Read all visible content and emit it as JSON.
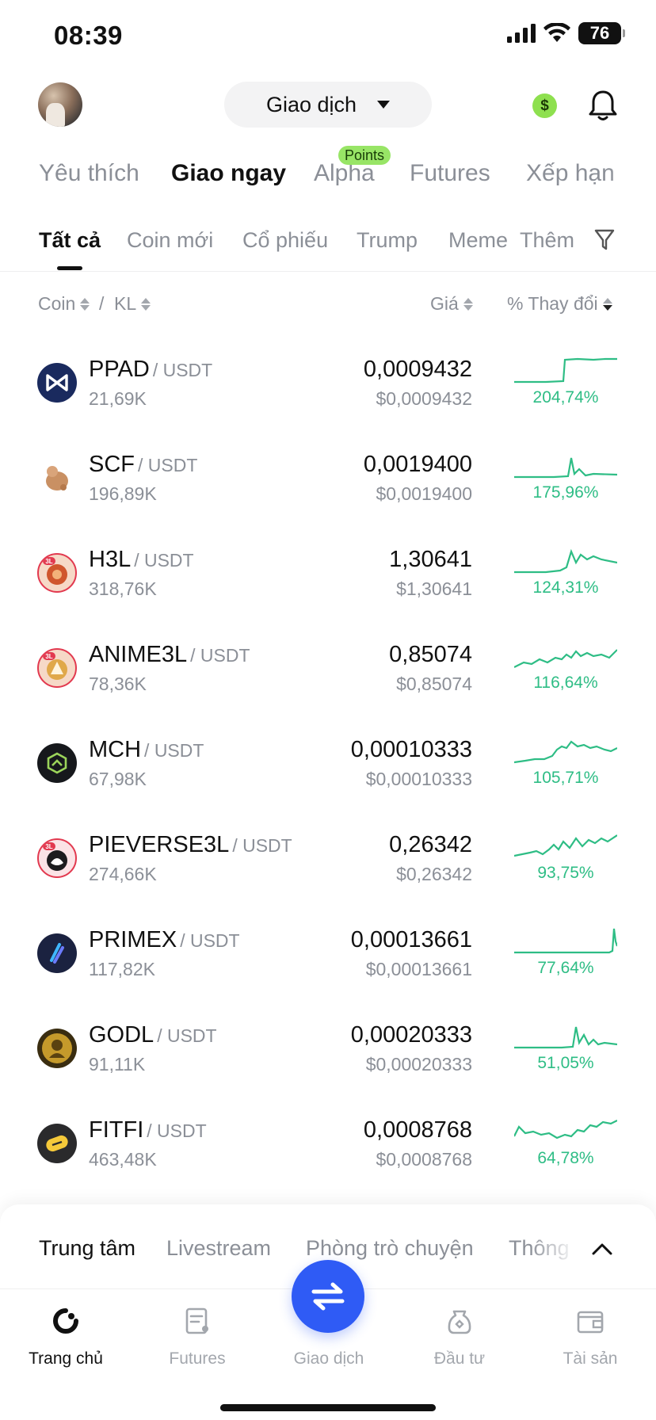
{
  "status_bar": {
    "time": "08:39",
    "battery": "76"
  },
  "header": {
    "title": "Giao dịch",
    "points_badge": "Points"
  },
  "main_tabs": [
    "Yêu thích",
    "Giao ngay",
    "Alpha",
    "Futures",
    "Xếp hạn"
  ],
  "sub_tabs": [
    "Tất cả",
    "Coin mới",
    "Cổ phiếu",
    "Trump",
    "Meme",
    "Thêm"
  ],
  "columns": {
    "coin": "Coin",
    "separator": "/",
    "volume": "KL",
    "price": "Giá",
    "change": "% Thay đổi"
  },
  "rows": [
    {
      "base": "PPAD",
      "quote": "/ USDT",
      "volume": "21,69K",
      "price": "0,0009432",
      "price_usd": "$0,0009432",
      "change": "204,74%"
    },
    {
      "base": "SCF",
      "quote": "/ USDT",
      "volume": "196,89K",
      "price": "0,0019400",
      "price_usd": "$0,0019400",
      "change": "175,96%"
    },
    {
      "base": "H3L",
      "quote": "/ USDT",
      "volume": "318,76K",
      "price": "1,30641",
      "price_usd": "$1,30641",
      "change": "124,31%"
    },
    {
      "base": "ANIME3L",
      "quote": "/ USDT",
      "volume": "78,36K",
      "price": "0,85074",
      "price_usd": "$0,85074",
      "change": "116,64%"
    },
    {
      "base": "MCH",
      "quote": "/ USDT",
      "volume": "67,98K",
      "price": "0,00010333",
      "price_usd": "$0,00010333",
      "change": "105,71%"
    },
    {
      "base": "PIEVERSE3L",
      "quote": "/ USDT",
      "volume": "274,66K",
      "price": "0,26342",
      "price_usd": "$0,26342",
      "change": "93,75%"
    },
    {
      "base": "PRIMEX",
      "quote": "/ USDT",
      "volume": "117,82K",
      "price": "0,00013661",
      "price_usd": "$0,00013661",
      "change": "77,64%"
    },
    {
      "base": "GODL",
      "quote": "/ USDT",
      "volume": "91,11K",
      "price": "0,00020333",
      "price_usd": "$0,00020333",
      "change": "51,05%"
    },
    {
      "base": "FITFI",
      "quote": "/ USDT",
      "volume": "463,48K",
      "price": "0,0008768",
      "price_usd": "$0,0008768",
      "change": "64,78%"
    }
  ],
  "panel_tabs": [
    "Trung tâm",
    "Livestream",
    "Phòng trò chuyện",
    "Thông"
  ],
  "bottom_nav": [
    "Trang chủ",
    "Futures",
    "Giao dịch",
    "Đầu tư",
    "Tài sản"
  ],
  "colors": {
    "accent_blue": "#2f5bf5",
    "positive_green": "#2ebd85",
    "points_green": "#98e566"
  }
}
